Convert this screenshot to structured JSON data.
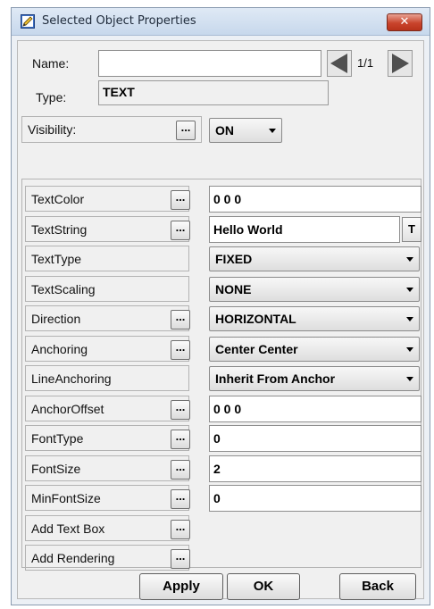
{
  "window": {
    "title": "Selected Object Properties",
    "close_glyph": "✕"
  },
  "header": {
    "name_label": "Name:",
    "name_value": "",
    "pager": "1/1",
    "type_label": "Type:",
    "type_value": "TEXT",
    "visibility_label": "Visibility:",
    "visibility_value": "ON"
  },
  "properties": [
    {
      "label": "TextColor",
      "has_dots": true,
      "kind": "text",
      "value": "0 0 0"
    },
    {
      "label": "TextString",
      "has_dots": true,
      "kind": "text-t",
      "value": "Hello World",
      "t_label": "T"
    },
    {
      "label": "TextType",
      "has_dots": false,
      "kind": "select",
      "value": "FIXED"
    },
    {
      "label": "TextScaling",
      "has_dots": false,
      "kind": "select",
      "value": "NONE"
    },
    {
      "label": "Direction",
      "has_dots": true,
      "kind": "select",
      "value": "HORIZONTAL"
    },
    {
      "label": "Anchoring",
      "has_dots": true,
      "kind": "select",
      "value": "Center Center"
    },
    {
      "label": "LineAnchoring",
      "has_dots": false,
      "kind": "select",
      "value": "Inherit From Anchor"
    },
    {
      "label": "AnchorOffset",
      "has_dots": true,
      "kind": "text",
      "value": "0 0 0"
    },
    {
      "label": "FontType",
      "has_dots": true,
      "kind": "text",
      "value": "0"
    },
    {
      "label": "FontSize",
      "has_dots": true,
      "kind": "text",
      "value": "2"
    },
    {
      "label": "MinFontSize",
      "has_dots": true,
      "kind": "text",
      "value": "0"
    },
    {
      "label": "Add Text Box",
      "has_dots": true,
      "kind": "none",
      "value": ""
    },
    {
      "label": "Add Rendering",
      "has_dots": true,
      "kind": "none",
      "value": ""
    }
  ],
  "dots_label": "...",
  "buttons": {
    "apply": "Apply",
    "ok": "OK",
    "back": "Back"
  },
  "colors": {
    "titlebar": "#c7d8ec",
    "close": "#c9442c",
    "background": "#f0f0f0"
  }
}
